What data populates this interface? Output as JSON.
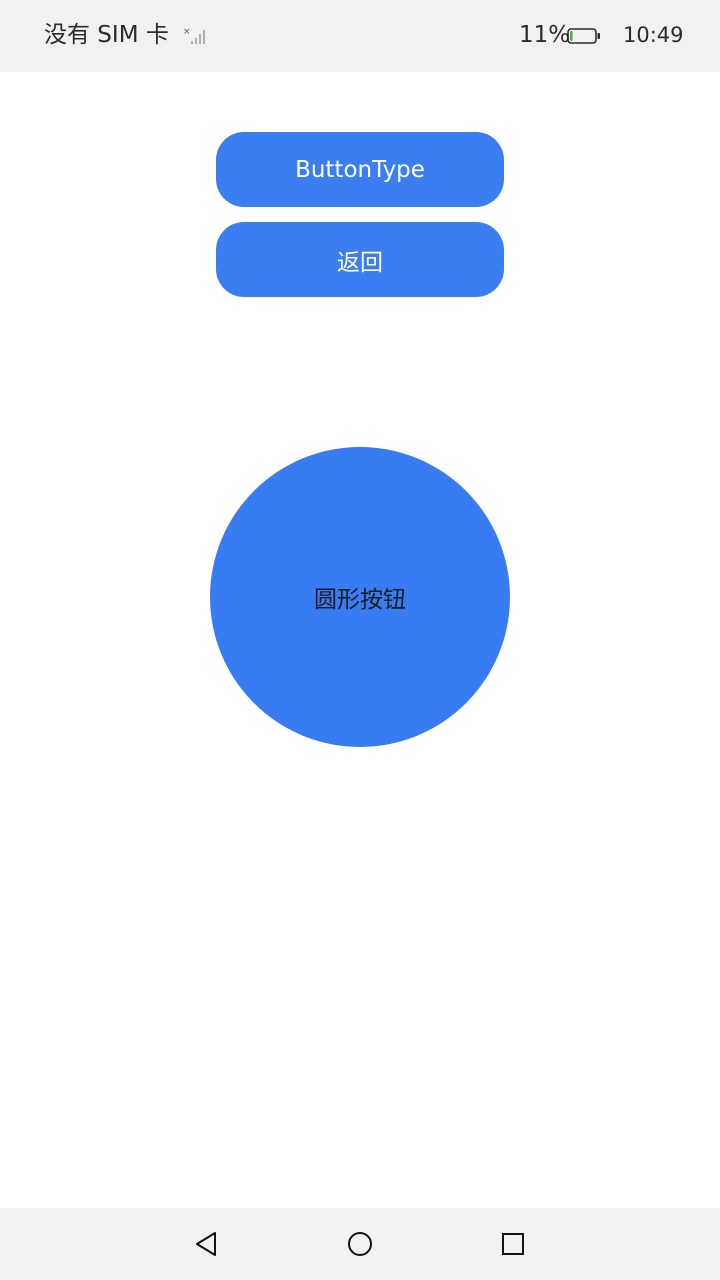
{
  "status_bar": {
    "carrier": "没有 SIM 卡",
    "signal_icon": "no-signal-icon",
    "battery_percent": "11%",
    "battery_level": 0.11,
    "battery_icon": "battery-icon",
    "time": "10:49"
  },
  "buttons": {
    "button_type_label": "ButtonType",
    "back_label": "返回",
    "circle_label": "圆形按钮"
  },
  "nav_bar": {
    "back_icon": "triangle-back-icon",
    "home_icon": "circle-home-icon",
    "recent_icon": "square-recent-icon"
  },
  "colors": {
    "accent": "#3a7ef2",
    "status_bar_bg": "#f1f1f3",
    "battery_fill": "#4caf50"
  }
}
